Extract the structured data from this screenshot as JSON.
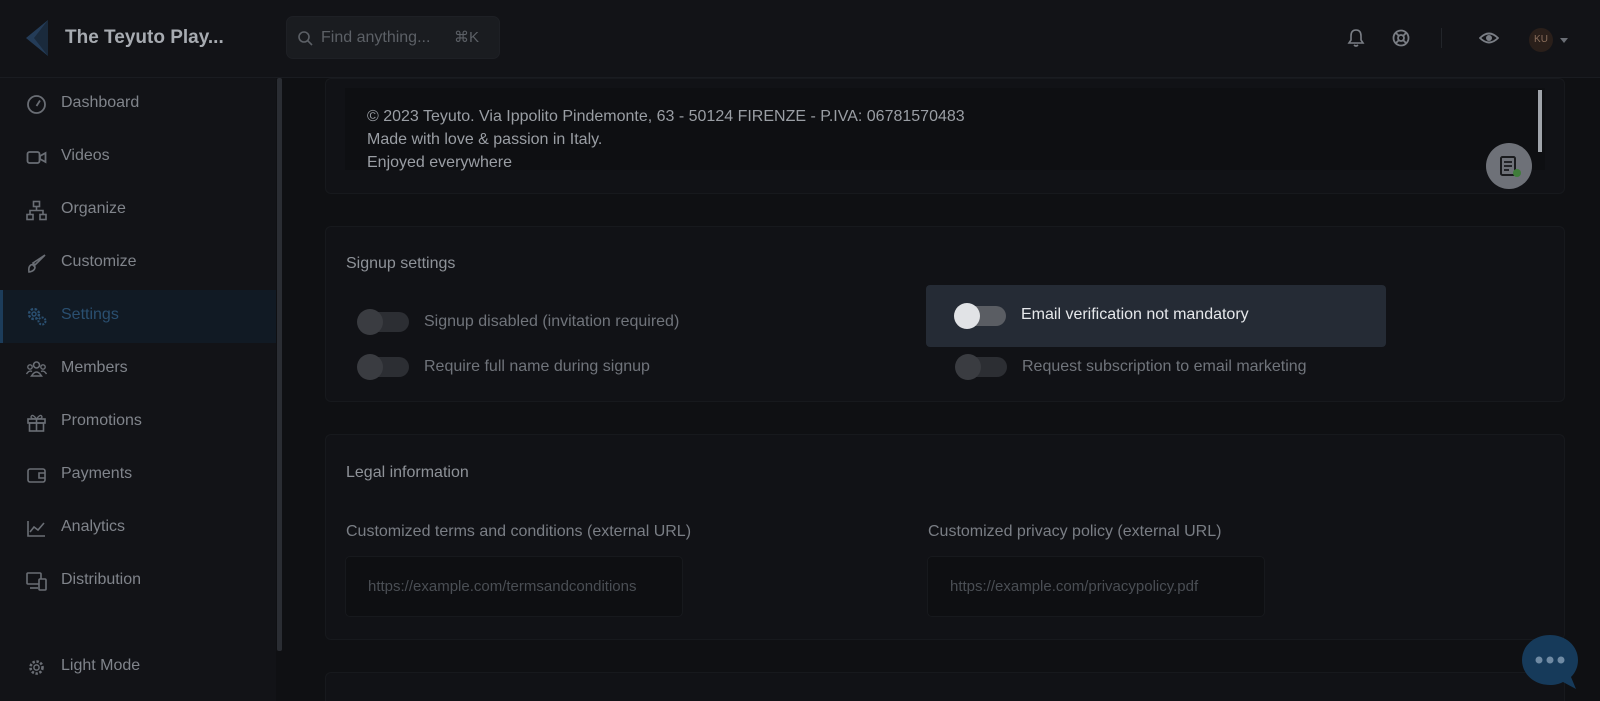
{
  "app": {
    "title": "The Teyuto Play..."
  },
  "search": {
    "placeholder": "Find anything...",
    "shortcut": "⌘K"
  },
  "header": {
    "avatar_initials": "KU",
    "icons": [
      "bell-icon",
      "lifebuoy-icon",
      "eye-icon"
    ]
  },
  "sidebar": {
    "items": [
      {
        "label": "Dashboard",
        "icon": "gauge-icon"
      },
      {
        "label": "Videos",
        "icon": "video-camera-icon"
      },
      {
        "label": "Organize",
        "icon": "sitemap-icon"
      },
      {
        "label": "Customize",
        "icon": "brush-icon"
      },
      {
        "label": "Settings",
        "icon": "gears-icon",
        "active": true
      },
      {
        "label": "Members",
        "icon": "users-icon"
      },
      {
        "label": "Promotions",
        "icon": "gift-icon"
      },
      {
        "label": "Payments",
        "icon": "wallet-icon"
      },
      {
        "label": "Analytics",
        "icon": "chart-line-icon"
      },
      {
        "label": "Distribution",
        "icon": "devices-icon"
      }
    ],
    "theme_toggle": {
      "label": "Light Mode",
      "icon": "sun-gear-icon"
    }
  },
  "footer_text": {
    "lines": [
      "© 2023 Teyuto. Via Ippolito Pindemonte, 63 - 50124 FIRENZE - P.IVA: 06781570483",
      "Made with love & passion in Italy.",
      "Enjoyed everywhere"
    ]
  },
  "signup": {
    "title": "Signup settings",
    "toggles": [
      {
        "label": "Signup disabled (invitation required)",
        "on": false
      },
      {
        "label": "Email verification not mandatory",
        "on": false,
        "highlighted": true
      },
      {
        "label": "Require full name during signup",
        "on": false
      },
      {
        "label": "Request subscription to email marketing",
        "on": false
      }
    ]
  },
  "legal": {
    "title": "Legal information",
    "terms": {
      "label": "Customized terms and conditions (external URL)",
      "placeholder": "https://example.com/termsandconditions"
    },
    "privacy": {
      "label": "Customized privacy policy (external URL)",
      "placeholder": "https://example.com/privacypolicy.pdf"
    }
  },
  "colors": {
    "background": "#0f1013",
    "accent": "#1c3c5a",
    "highlight": "#252b35",
    "chat": "#163a5a"
  }
}
